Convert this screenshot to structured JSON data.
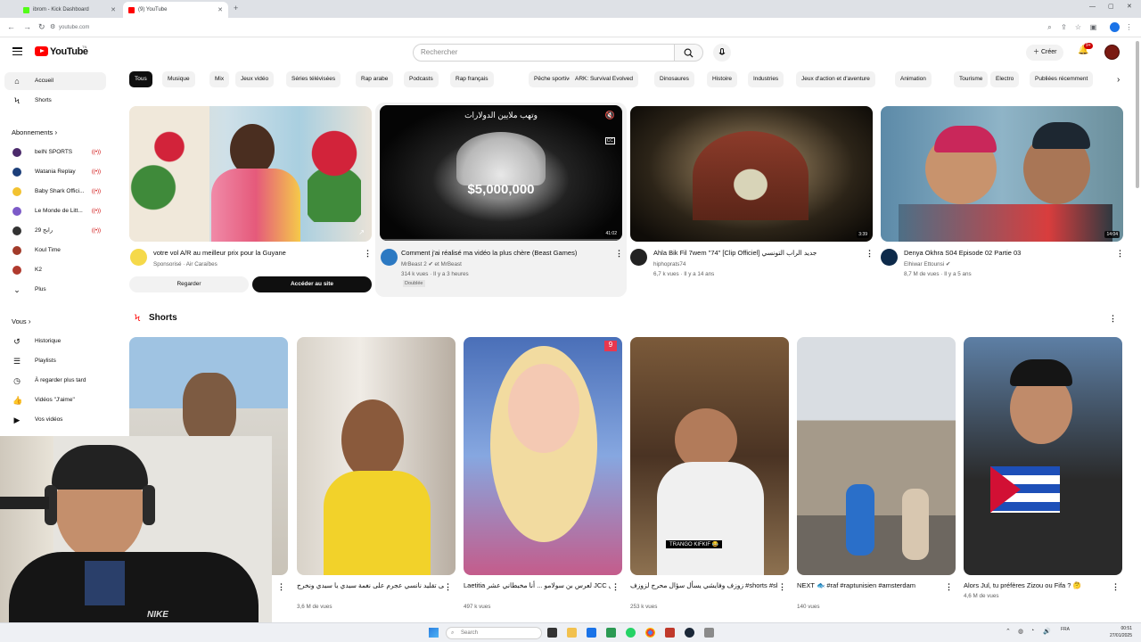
{
  "browser": {
    "tabs": [
      {
        "label": "ibrom - Kick Dashboard",
        "favicon_color": "#53fc18"
      },
      {
        "label": "(9) YouTube",
        "favicon_color": "#ff0000"
      }
    ],
    "url": "youtube.com"
  },
  "header": {
    "logo": "YouTube",
    "logo_country": "TN",
    "search_placeholder": "Rechercher",
    "create_label": "Créer",
    "notifications_badge": "9+"
  },
  "chips": [
    "Tous",
    "Musique",
    "Mix",
    "Jeux vidéo",
    "Séries télévisées",
    "Rap arabe",
    "Podcasts",
    "Rap français",
    "Pêche sportive",
    "ARK: Survival Evolved",
    "Dinosaures",
    "Histoire",
    "Industries",
    "Jeux d'action et d'aventure",
    "Animation",
    "Tourisme",
    "Electro",
    "Publiées récemment"
  ],
  "sidebar": {
    "main": [
      {
        "label": "Accueil",
        "icon": "home-icon"
      },
      {
        "label": "Shorts",
        "icon": "shorts-icon"
      }
    ],
    "subscriptions_title": "Abonnements",
    "subscriptions": [
      {
        "label": "beIN SPORTS",
        "color": "#4b2a6b",
        "live": true
      },
      {
        "label": "Watania Replay",
        "color": "#1c3f7a",
        "live": true
      },
      {
        "label": "Baby Shark Offici...",
        "color": "#f2c230",
        "live": true
      },
      {
        "label": "Le Monde de Litt...",
        "color": "#7c5ac8",
        "live": true
      },
      {
        "label": "29 رابح",
        "color": "#333333",
        "live": true
      },
      {
        "label": "Koul Time",
        "color": "#a23b2a",
        "live": false
      },
      {
        "label": "K2",
        "color": "#b03a2e",
        "live": false
      }
    ],
    "more_label": "Plus",
    "you_title": "Vous",
    "you_items": [
      {
        "label": "Historique",
        "icon": "history-icon"
      },
      {
        "label": "Playlists",
        "icon": "playlists-icon"
      },
      {
        "label": "À regarder plus tard",
        "icon": "watch-later-icon"
      },
      {
        "label": "Vidéos \"J'aime\"",
        "icon": "like-icon"
      },
      {
        "label": "Vos vidéos",
        "icon": "your-videos-icon"
      }
    ]
  },
  "videos": [
    {
      "title": "votre vol A/R au meilleur prix pour la Guyane",
      "channel": "Sponsorisé · Air Caraïbes",
      "meta": "",
      "duration": "",
      "watch_label": "Regarder",
      "cta_label": "Accéder au site"
    },
    {
      "title": "Comment j'ai réalisé ma vidéo la plus chère (Beast Games)",
      "channel": "MrBeast 2 ✔ et MrBeast",
      "meta": "314 k vues · Il y a 3 heures",
      "extra": "Doublée",
      "duration": "41:02",
      "overlay_text": "$5,000,000",
      "overlay_arabic": "وتهب ملايين الدولارات"
    },
    {
      "title": "Ahla Bik Fil 7wem \"74\" [Clip Officiel] جديد الراب التونسي",
      "channel": "hiphoprats74",
      "meta": "6,7 k vues · Il y a 14 ans",
      "duration": "3:39"
    },
    {
      "title": "Denya Okhra S04 Episode 02 Partie 03",
      "channel": "Elhiwar Ettounsi ✔",
      "meta": "8,7 M de vues · Il y a 5 ans",
      "duration": "14:04"
    }
  ],
  "shorts_title": "Shorts",
  "shorts": [
    {
      "title": "",
      "views": ""
    },
    {
      "title": "أحلى تقليد نانسي عجرم على نغمة سيدي يا سيدي ونخرج / Nancy Ajram Sidi Ya Sidi",
      "views": "3,6 M de vues"
    },
    {
      "title": "Laetitia لعرس بن سولامو ... أنا مخبطاني عشر  JCC كي تحب تحكي على",
      "views": "497 k vues"
    },
    {
      "title": "زوزف وفايشي يسأل سؤال محرج لزوزف #shorts #short #trending #memes ...",
      "views": "253 k vues",
      "caption": "TRANGO KIFKIF 😂"
    },
    {
      "title": "NEXT 🐟 #raf #raptunisien #amsterdam",
      "views": "140 vues"
    },
    {
      "title": "Alors Jul, tu préfères Zizou ou Fifa ? 🤔",
      "views": "4,6 M de vues"
    }
  ],
  "taskbar": {
    "search_placeholder": "Search",
    "lang": "FRA",
    "time": "00:51",
    "date": "27/01/2025"
  }
}
